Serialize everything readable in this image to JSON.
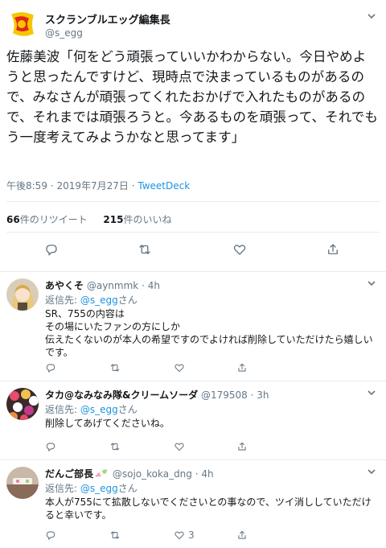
{
  "main_tweet": {
    "display_name": "スクランブルエッグ編集長",
    "handle": "@s_egg",
    "text": "佐藤美波「何をどう頑張っていいかわからない。今日やめようと思ったんですけど、現時点で決まっているものがあるので、みなさんが頑張ってくれたおかげで入れたものがあるので、それまでは頑張ろうと。今あるものを頑張って、それでもう一度考えてみようかなと思ってます」",
    "time": "午後8:59",
    "sep1": "·",
    "date": "2019年7月27日",
    "sep2": "·",
    "via": "TweetDeck",
    "retweet_count": "66",
    "retweet_label": "件のリツイート",
    "like_count": "215",
    "like_label": "件のいいね"
  },
  "replies": [
    {
      "display_name": "あやくそ",
      "handle": "@aynmmk",
      "dot": "·",
      "time": "4h",
      "reply_to_prefix": "返信先: ",
      "reply_to_handle": "@s_egg",
      "reply_to_suffix": "さん",
      "body_lines": [
        "SR、755の内容は",
        "その場にいたファンの方にしか",
        "伝えたくないのが本人の希望ですのでよければ削除していただけたら嬉しい",
        "です。"
      ],
      "retweets": "",
      "likes": ""
    },
    {
      "display_name": "タカ@なみなみ隊&クリームソーダ",
      "handle": "@179508",
      "dot": "·",
      "time": "3h",
      "reply_to_prefix": "返信先: ",
      "reply_to_handle": "@s_egg",
      "reply_to_suffix": "さん",
      "body_lines": [
        "削除してあげてくださいね。"
      ],
      "retweets": "",
      "likes": ""
    },
    {
      "display_name": "だんご部長",
      "handle": "@sojo_koka_dng",
      "dot": "·",
      "time": "4h",
      "reply_to_prefix": "返信先: ",
      "reply_to_handle": "@s_egg",
      "reply_to_suffix": "さん",
      "body_lines": [
        "本人が755にて拡散しないでくださいとの事なので、ツイ消ししていただけ",
        "ると幸いです。"
      ],
      "retweets": "",
      "likes": "3"
    }
  ],
  "colors": {
    "link": "#1b95e0",
    "secondary_text": "#657786",
    "divider": "#e6ecf0",
    "logo_yellow": "#f7c600",
    "logo_red": "#e0261b"
  },
  "icons": [
    "reply-icon",
    "retweet-icon",
    "like-icon",
    "share-icon",
    "chevron-down-icon"
  ]
}
